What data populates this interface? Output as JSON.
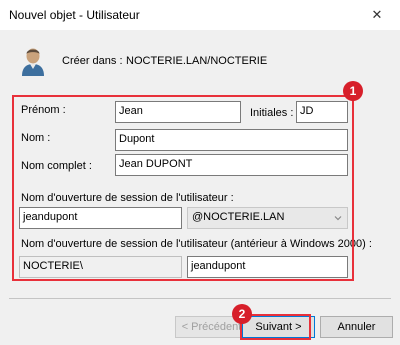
{
  "window": {
    "title": "Nouvel objet - Utilisateur",
    "close_glyph": "✕"
  },
  "header": {
    "create_in_label": "Créer dans :",
    "create_in_value": "NOCTERIE.LAN/NOCTERIE",
    "icon": "user-icon"
  },
  "form": {
    "first_name_label": "Prénom :",
    "first_name_value": "Jean",
    "initials_label": "Initiales :",
    "initials_value": "JD",
    "last_name_label": "Nom :",
    "last_name_value": "Dupont",
    "full_name_label": "Nom complet :",
    "full_name_value": "Jean DUPONT",
    "logon_label": "Nom d'ouverture de session de l'utilisateur :",
    "logon_value": "jeandupont",
    "domain_value": "@NOCTERIE.LAN",
    "legacy_logon_label": "Nom d'ouverture de session de l'utilisateur (antérieur à Windows 2000) :",
    "legacy_domain_value": "NOCTERIE\\",
    "legacy_logon_value": "jeandupont"
  },
  "annotations": {
    "badge_1": "1",
    "badge_2": "2",
    "color": "#d71f2a"
  },
  "buttons": {
    "previous": "< Précédent",
    "next": "Suivant >",
    "cancel": "Annuler"
  }
}
